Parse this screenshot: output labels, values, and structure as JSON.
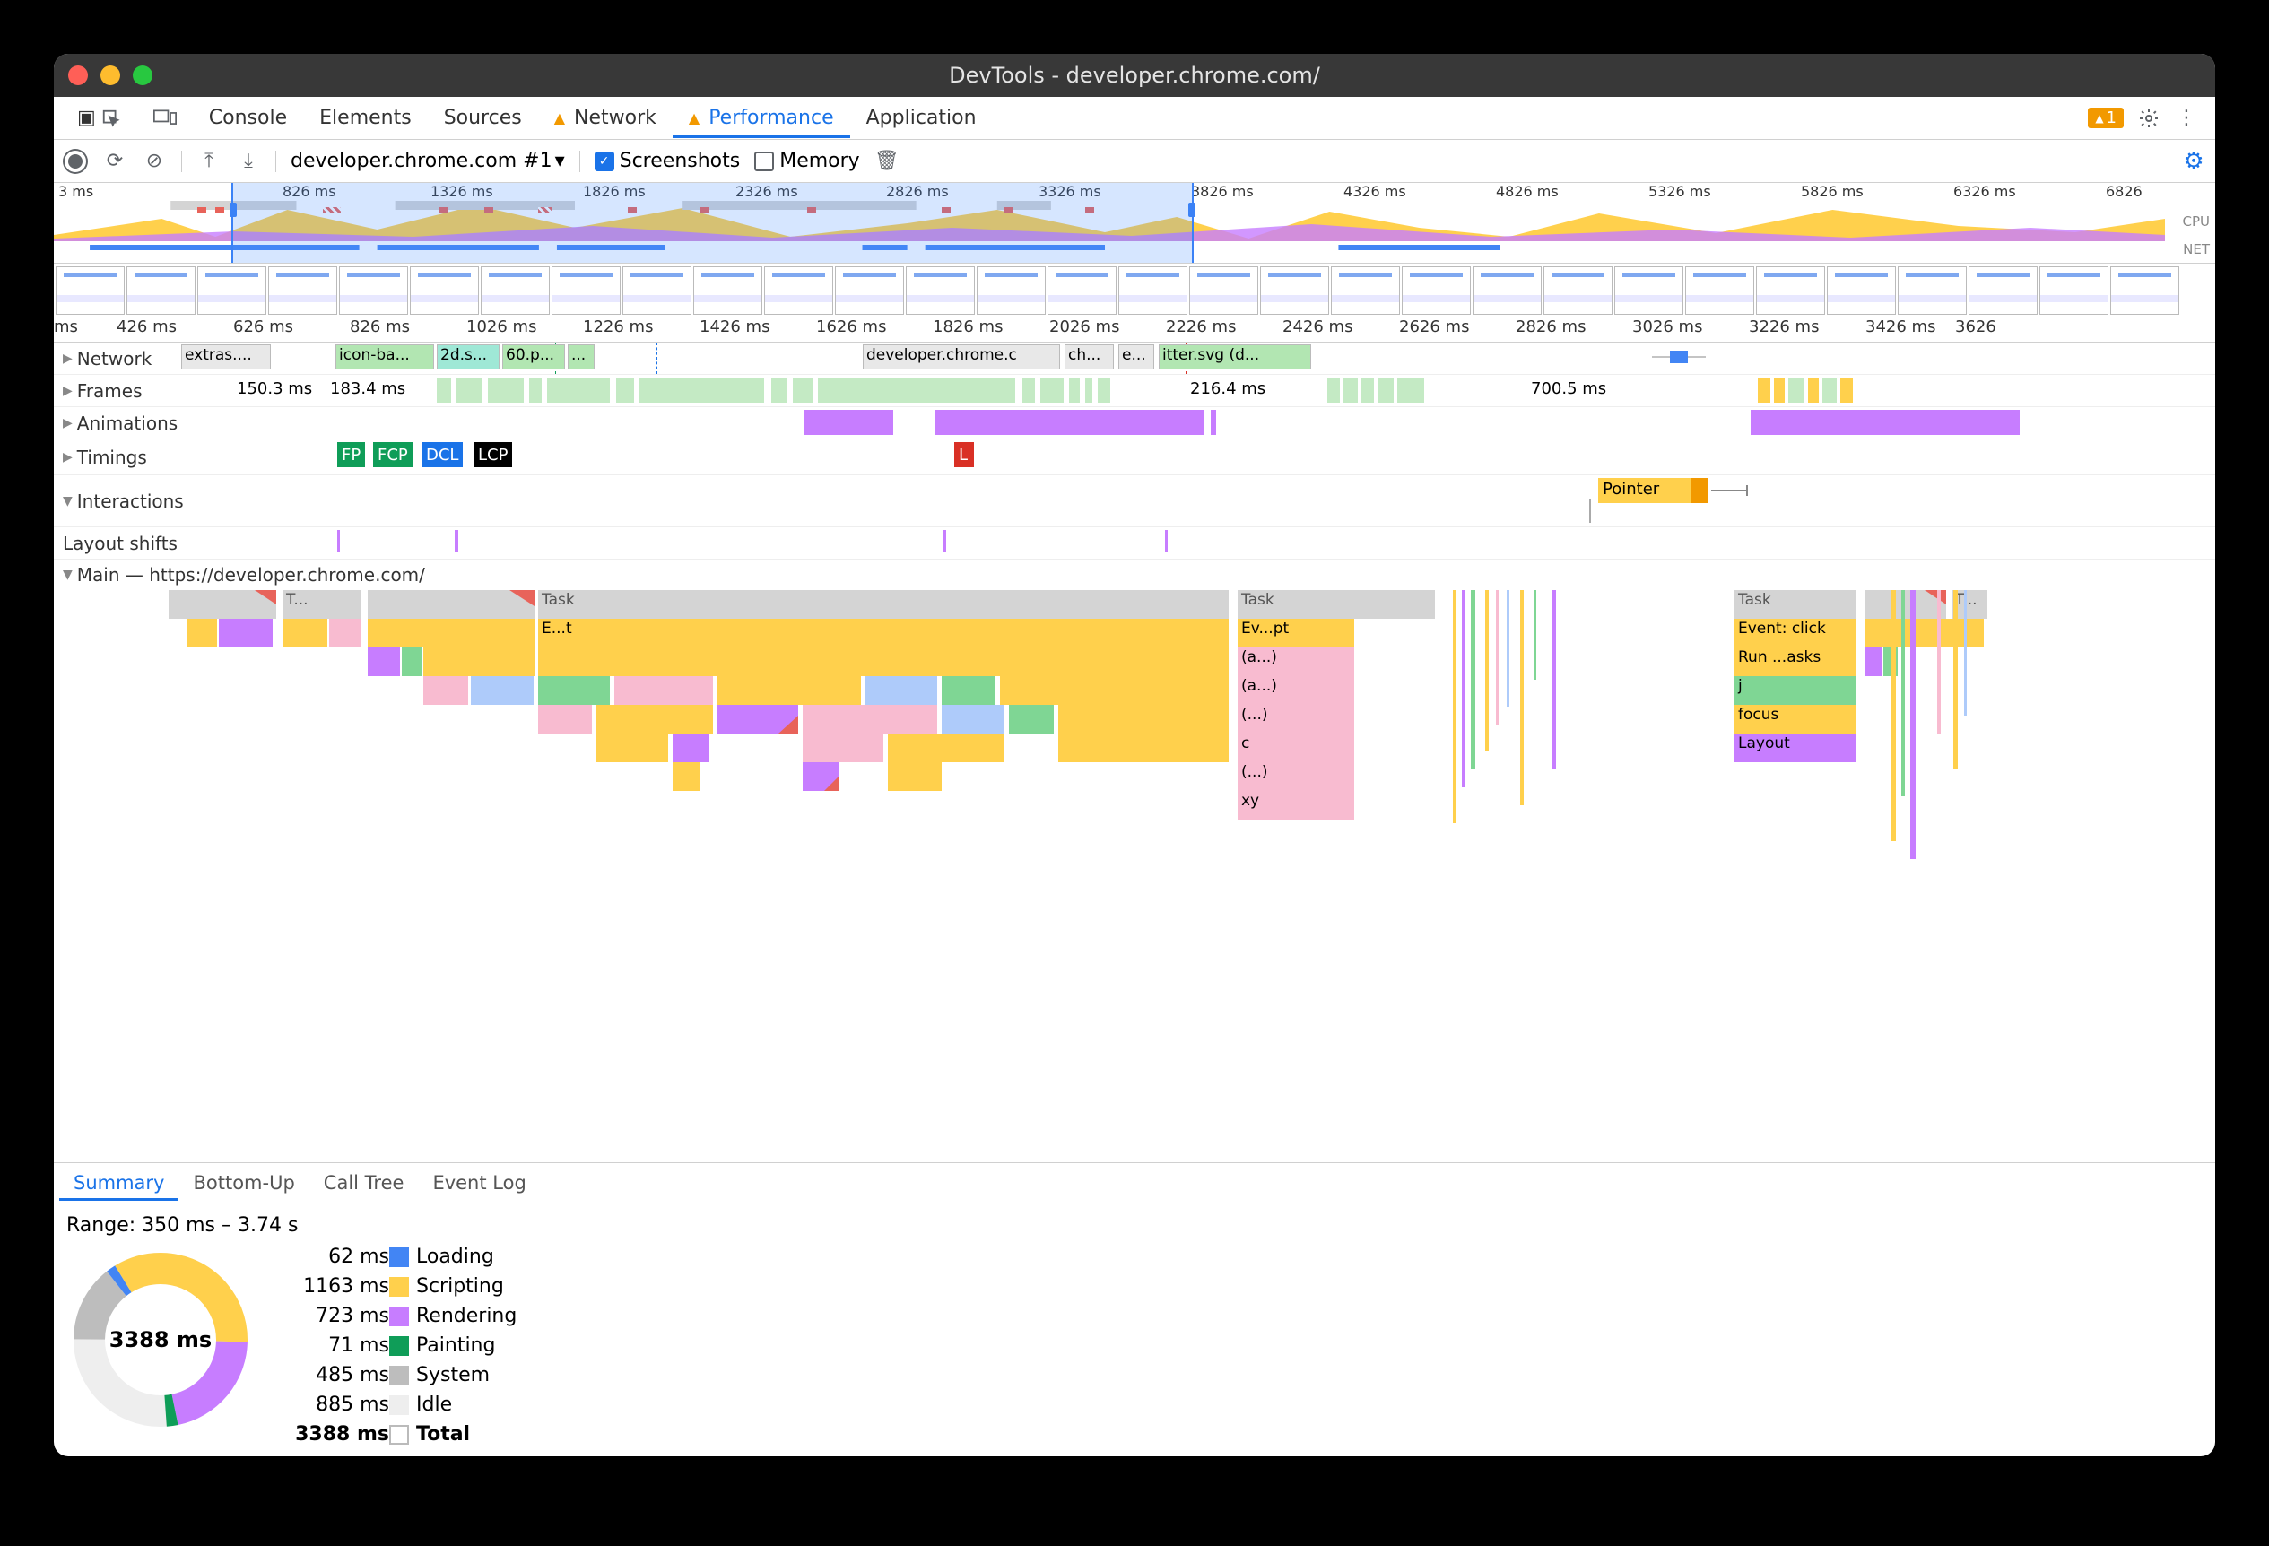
{
  "window": {
    "title": "DevTools - developer.chrome.com/"
  },
  "tabs": {
    "items": [
      "Console",
      "Elements",
      "Sources",
      "Network",
      "Performance",
      "Application"
    ],
    "active": 4,
    "warn_indices": [
      3,
      4
    ],
    "warn_badge": "1"
  },
  "toolbar": {
    "dropdown": "developer.chrome.com #1",
    "screenshots": {
      "label": "Screenshots",
      "checked": true
    },
    "memory": {
      "label": "Memory",
      "checked": false
    }
  },
  "overview": {
    "ticks": [
      "3 ms",
      "826 ms",
      "1326 ms",
      "1826 ms",
      "2326 ms",
      "2826 ms",
      "3326 ms",
      "3826 ms",
      "4326 ms",
      "4826 ms",
      "5326 ms",
      "5826 ms",
      "6326 ms",
      "6826"
    ],
    "label_cpu": "CPU",
    "label_net": "NET",
    "selection": {
      "start_pct": 8.4,
      "end_pct": 54.0
    }
  },
  "detail": {
    "ticks": [
      "ms",
      "426 ms",
      "626 ms",
      "826 ms",
      "1026 ms",
      "1226 ms",
      "1426 ms",
      "1626 ms",
      "1826 ms",
      "2026 ms",
      "2226 ms",
      "2426 ms",
      "2626 ms",
      "2826 ms",
      "3026 ms",
      "3226 ms",
      "3426 ms",
      "3626"
    ]
  },
  "tracks": {
    "network": {
      "label": "Network",
      "items": [
        "extras....",
        "icon-ba...",
        "2d.s...",
        "60.p...",
        "...",
        "developer.chrome.c",
        "ch...",
        "e...",
        "itter.svg (d..."
      ]
    },
    "frames": {
      "label": "Frames",
      "labels": [
        "150.3 ms",
        "183.4 ms",
        "216.4 ms",
        "700.5 ms"
      ]
    },
    "animations": {
      "label": "Animations"
    },
    "timings": {
      "label": "Timings",
      "tags": [
        "FP",
        "FCP",
        "DCL",
        "LCP",
        "L"
      ]
    },
    "interactions": {
      "label": "Interactions",
      "pointer": "Pointer"
    },
    "layout_shifts": {
      "label": "Layout shifts"
    },
    "main": {
      "label": "Main — https://developer.chrome.com/"
    }
  },
  "main_tasks": {
    "top": [
      "T...",
      "Task",
      "Task",
      "Task",
      "T..."
    ],
    "sub": [
      "E...t",
      "Ev...pt",
      "(a...)",
      "(a...)",
      "(...)",
      "c",
      "(...)",
      "xy"
    ],
    "right": [
      "Event: click",
      "Run ...asks",
      "j",
      "focus",
      "Layout"
    ]
  },
  "summary_tabs": [
    "Summary",
    "Bottom-Up",
    "Call Tree",
    "Event Log"
  ],
  "summary": {
    "range": "Range: 350 ms – 3.74 s",
    "total_center": "3388 ms",
    "rows": [
      {
        "val": "62 ms",
        "label": "Loading",
        "cls": "sw-load"
      },
      {
        "val": "1163 ms",
        "label": "Scripting",
        "cls": "sw-script"
      },
      {
        "val": "723 ms",
        "label": "Rendering",
        "cls": "sw-render"
      },
      {
        "val": "71 ms",
        "label": "Painting",
        "cls": "sw-paint"
      },
      {
        "val": "485 ms",
        "label": "System",
        "cls": "sw-sys"
      },
      {
        "val": "885 ms",
        "label": "Idle",
        "cls": "sw-idle"
      },
      {
        "val": "3388 ms",
        "label": "Total",
        "cls": "sw-total",
        "bold": true
      }
    ]
  },
  "chart_data": {
    "type": "pie",
    "title": "Performance time breakdown",
    "series": [
      {
        "name": "Loading",
        "value": 62,
        "color": "#4285f4"
      },
      {
        "name": "Scripting",
        "value": 1163,
        "color": "#ffd04c"
      },
      {
        "name": "Rendering",
        "value": 723,
        "color": "#c77dff"
      },
      {
        "name": "Painting",
        "value": 71,
        "color": "#0f9d58"
      },
      {
        "name": "System",
        "value": 485,
        "color": "#bdbdbd"
      },
      {
        "name": "Idle",
        "value": 885,
        "color": "#eeeeee"
      }
    ],
    "total_ms": 3388,
    "range_start_ms": 350,
    "range_end_s": 3.74
  }
}
